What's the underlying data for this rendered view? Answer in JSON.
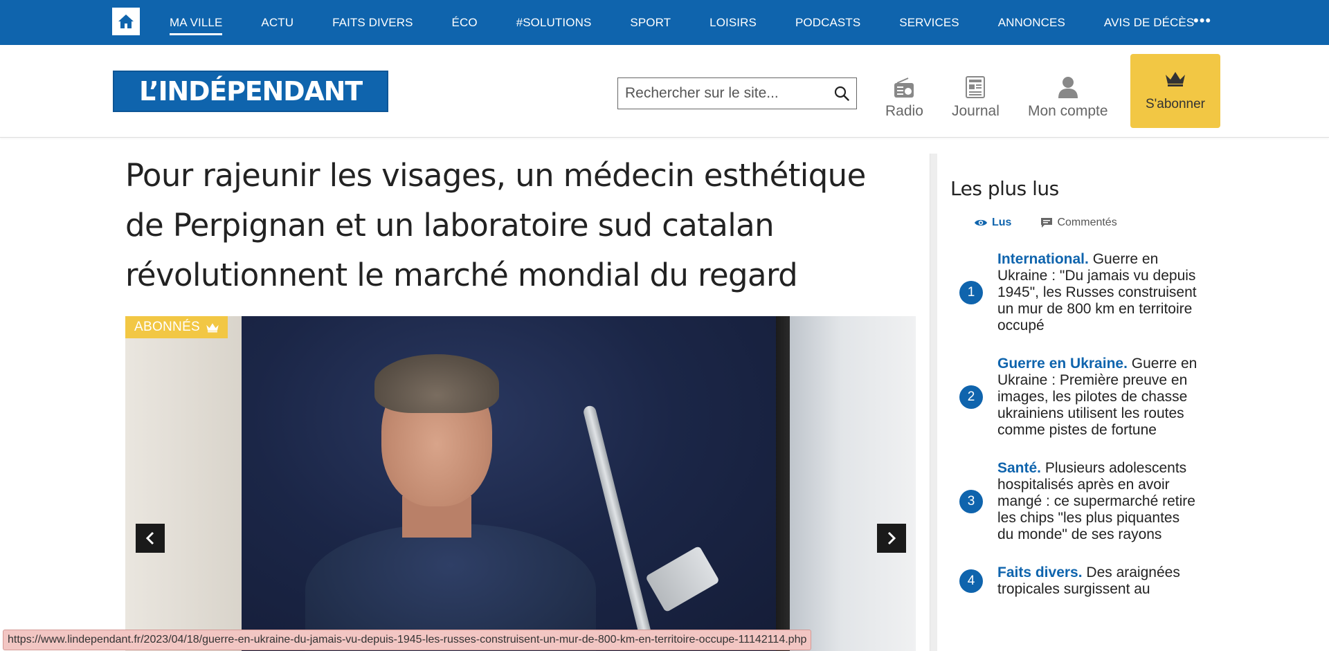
{
  "nav": {
    "items": [
      "MA VILLE",
      "ACTU",
      "FAITS DIVERS",
      "ÉCO",
      "#SOLUTIONS",
      "SPORT",
      "LOISIRS",
      "PODCASTS",
      "SERVICES",
      "ANNONCES",
      "AVIS DE DÉCÈS"
    ],
    "active": "MA VILLE",
    "more_label": "•••"
  },
  "header": {
    "logo_text": "L’INDÉPENDANT",
    "search_placeholder": "Rechercher sur le site...",
    "radio_label": "Radio",
    "journal_label": "Journal",
    "account_label": "Mon compte",
    "subscribe_label": "S'abonner"
  },
  "article": {
    "title": "Pour rajeunir les visages, un médecin esthétique de Perpignan et un laboratoire sud catalan révolutionnent le marché mondial du regard",
    "badge": "ABONNÉS"
  },
  "sidebar": {
    "title": "Les plus lus",
    "tabs": [
      "Lus",
      "Commentés"
    ],
    "active_tab": "Lus",
    "items": [
      {
        "rank": "1",
        "category": "International.",
        "text": "Guerre en Ukraine : \"Du jamais vu depuis 1945\", les Russes construisent un mur de 800 km en territoire occupé"
      },
      {
        "rank": "2",
        "category": "Guerre en Ukraine.",
        "text": "Guerre en Ukraine : Première preuve en images, les pilotes de chasse ukrainiens utilisent les routes comme pistes de fortune"
      },
      {
        "rank": "3",
        "category": "Santé.",
        "text": "Plusieurs adolescents hospitalisés après en avoir mangé : ce supermarché retire les chips \"les plus piquantes du monde\" de ses rayons"
      },
      {
        "rank": "4",
        "category": "Faits divers.",
        "text": "Des araignées tropicales surgissent au"
      }
    ]
  },
  "statusbar": {
    "url": "https://www.lindependant.fr/2023/04/18/guerre-en-ukraine-du-jamais-vu-depuis-1945-les-russes-construisent-un-mur-de-800-km-en-territoire-occupe-11142114.php"
  },
  "colors": {
    "brand_blue": "#0f64ad",
    "subscribe_yellow": "#f2c744",
    "badge_yellow": "#f2c744"
  },
  "icons": [
    "home-icon",
    "more-icon",
    "search-icon",
    "radio-icon",
    "journal-icon",
    "user-icon",
    "crown-icon",
    "eye-icon",
    "comment-icon",
    "chevron-left-icon",
    "chevron-right-icon"
  ]
}
